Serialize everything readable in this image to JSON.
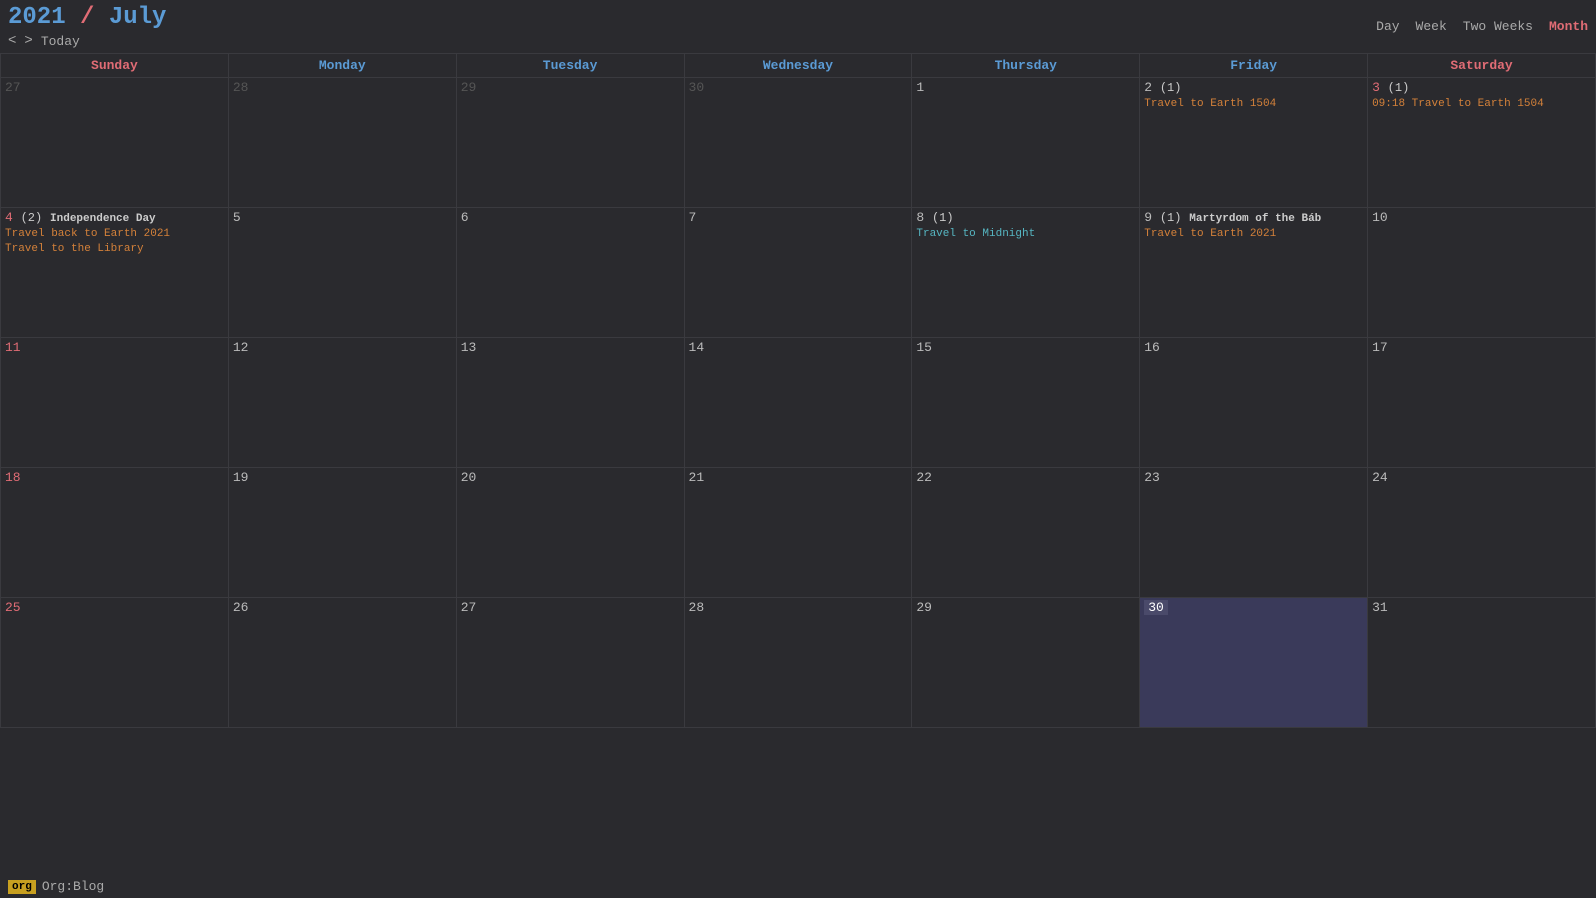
{
  "header": {
    "year": "2021",
    "slash": "/",
    "month": "July",
    "nav_prev": "<",
    "nav_next": ">",
    "today_label": "Today",
    "views": [
      "Day",
      "Week",
      "Two Weeks",
      "Month"
    ],
    "active_view": "Month"
  },
  "days_of_week": [
    {
      "label": "Sunday",
      "class": "sunday"
    },
    {
      "label": "Monday",
      "class": "monday"
    },
    {
      "label": "Tuesday",
      "class": "tuesday"
    },
    {
      "label": "Wednesday",
      "class": "wednesday"
    },
    {
      "label": "Thursday",
      "class": "thursday"
    },
    {
      "label": "Friday",
      "class": "friday"
    },
    {
      "label": "Saturday",
      "class": "saturday"
    }
  ],
  "weeks": [
    {
      "days": [
        {
          "num": "27",
          "prev": true,
          "events": []
        },
        {
          "num": "28",
          "prev": true,
          "events": []
        },
        {
          "num": "29",
          "prev": true,
          "events": []
        },
        {
          "num": "30",
          "prev": true,
          "events": []
        },
        {
          "num": "1",
          "events": []
        },
        {
          "num": "2",
          "badge": "(1)",
          "events": [
            {
              "text": "Travel to Earth 1504",
              "style": "orange"
            }
          ]
        },
        {
          "num": "3",
          "badge": "(1)",
          "red": true,
          "events": [
            {
              "text": "09:18 Travel to Earth 1504",
              "style": "orange"
            }
          ]
        }
      ]
    },
    {
      "days": [
        {
          "num": "4",
          "red": true,
          "badge": "(2)",
          "events": [
            {
              "text": "Independence Day",
              "style": "bold white"
            },
            {
              "text": "Travel back to Earth 2021",
              "style": "orange"
            },
            {
              "text": "Travel to the Library",
              "style": "orange"
            }
          ]
        },
        {
          "num": "5",
          "events": []
        },
        {
          "num": "6",
          "events": []
        },
        {
          "num": "7",
          "events": []
        },
        {
          "num": "8",
          "badge": "(1)",
          "events": [
            {
              "text": "Travel to Midnight",
              "style": "cyan"
            }
          ]
        },
        {
          "num": "9",
          "badge": "(1)",
          "events": [
            {
              "text": "Martyrdom of the Báb",
              "style": "bold white"
            },
            {
              "text": "Travel to Earth 2021",
              "style": "orange"
            }
          ]
        },
        {
          "num": "10",
          "events": []
        }
      ]
    },
    {
      "days": [
        {
          "num": "11",
          "red": true,
          "events": []
        },
        {
          "num": "12",
          "events": []
        },
        {
          "num": "13",
          "events": []
        },
        {
          "num": "14",
          "events": []
        },
        {
          "num": "15",
          "events": []
        },
        {
          "num": "16",
          "events": []
        },
        {
          "num": "17",
          "events": []
        }
      ]
    },
    {
      "days": [
        {
          "num": "18",
          "red": true,
          "events": []
        },
        {
          "num": "19",
          "events": []
        },
        {
          "num": "20",
          "events": []
        },
        {
          "num": "21",
          "events": []
        },
        {
          "num": "22",
          "events": []
        },
        {
          "num": "23",
          "events": []
        },
        {
          "num": "24",
          "events": []
        }
      ]
    },
    {
      "days": [
        {
          "num": "25",
          "red": true,
          "events": []
        },
        {
          "num": "26",
          "events": []
        },
        {
          "num": "27",
          "events": []
        },
        {
          "num": "28",
          "events": []
        },
        {
          "num": "29",
          "events": []
        },
        {
          "num": "30",
          "today": true,
          "events": []
        },
        {
          "num": "31",
          "events": []
        }
      ]
    }
  ],
  "footer": {
    "tag": "org",
    "label": "Org:Blog"
  }
}
